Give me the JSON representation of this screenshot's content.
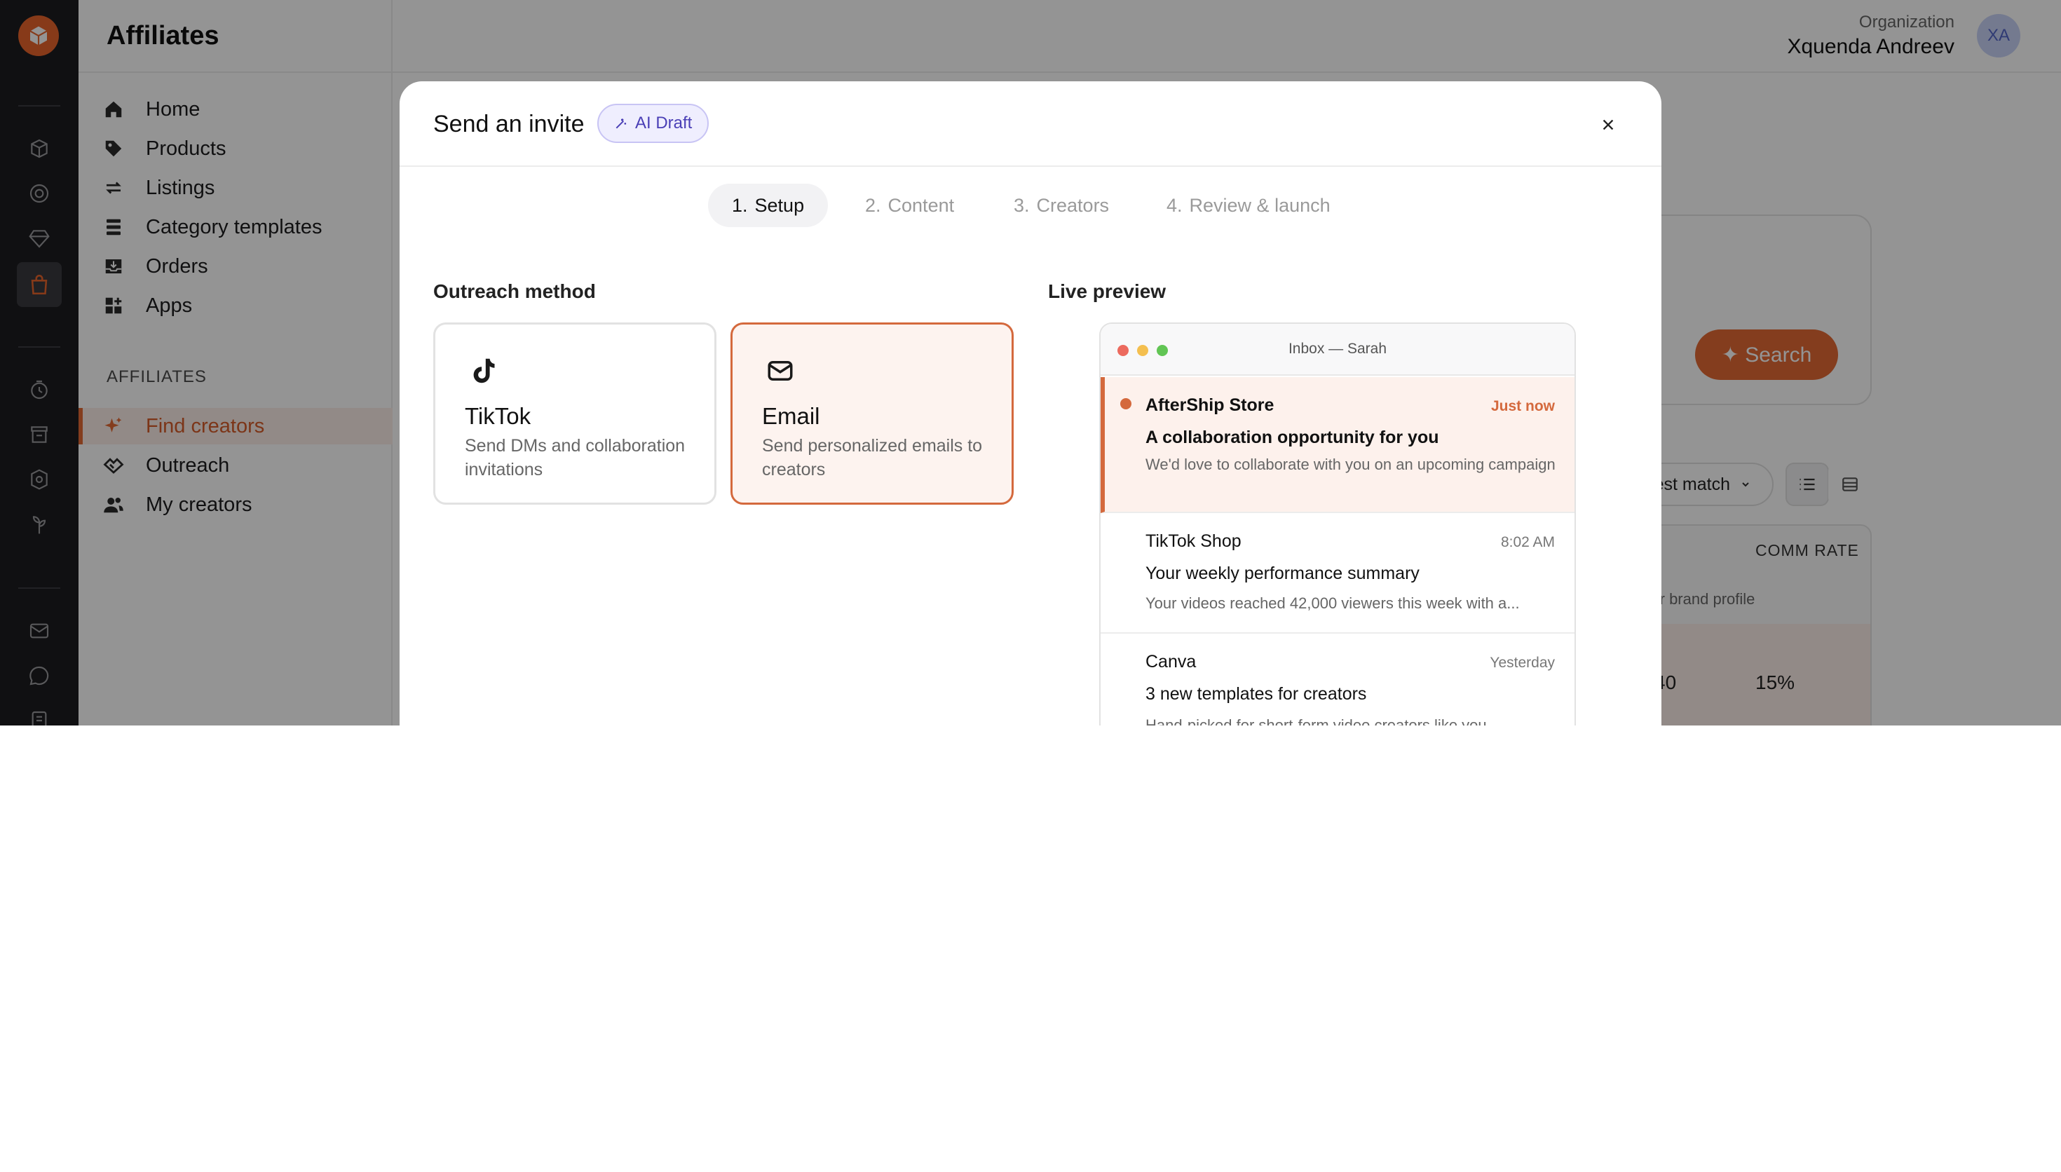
{
  "page": {
    "title": "Affiliates"
  },
  "org": {
    "label": "Organization",
    "name": "Xquenda Andreev",
    "initials": "XA"
  },
  "sidebar": {
    "items": [
      {
        "label": "Home",
        "icon": "home-icon"
      },
      {
        "label": "Products",
        "icon": "tag-icon"
      },
      {
        "label": "Listings",
        "icon": "sync-icon"
      },
      {
        "label": "Category templates",
        "icon": "layers-icon"
      },
      {
        "label": "Orders",
        "icon": "inbox-icon"
      },
      {
        "label": "Apps",
        "icon": "apps-icon"
      }
    ],
    "section_label": "AFFILIATES",
    "affiliate_items": [
      {
        "label": "Find creators",
        "icon": "sparkle-icon",
        "active": true
      },
      {
        "label": "Outreach",
        "icon": "handshake-icon"
      },
      {
        "label": "My creators",
        "icon": "users-icon"
      }
    ]
  },
  "background": {
    "search_fragment": "s",
    "search_button": "✦ Search",
    "sort_label": "est match",
    "column_header": "COMM RATE",
    "subtext": "sed on your brand profile",
    "value_a": "40",
    "value_b": "15%"
  },
  "modal": {
    "title": "Send an invite",
    "badge": "AI Draft",
    "steps": [
      {
        "num": "1.",
        "label": "Setup",
        "active": true
      },
      {
        "num": "2.",
        "label": "Content"
      },
      {
        "num": "3.",
        "label": "Creators"
      },
      {
        "num": "4.",
        "label": "Review & launch"
      }
    ],
    "outreach_title": "Outreach method",
    "methods": [
      {
        "title": "TikTok",
        "desc": "Send DMs and collaboration invitations",
        "icon": "tiktok-icon",
        "selected": false
      },
      {
        "title": "Email",
        "desc": "Send personalized emails to creators",
        "icon": "mail-icon",
        "selected": true
      }
    ],
    "preview_title": "Live preview",
    "inbox": {
      "title": "Inbox — Sarah",
      "messages": [
        {
          "sender": "AfterShip Store",
          "time": "Just now",
          "subject": "A collaboration opportunity for you",
          "preview": "We'd love to collaborate with you on an upcoming campaign",
          "unread": true
        },
        {
          "sender": "TikTok Shop",
          "time": "8:02 AM",
          "subject": "Your weekly performance summary",
          "preview": "Your videos reached 42,000 viewers this week with a..."
        },
        {
          "sender": "Canva",
          "time": "Yesterday",
          "subject": "3 new templates for creators",
          "preview": "Hand-picked for short-form video creators like you"
        }
      ]
    }
  },
  "colors": {
    "accent": "#e36a34",
    "rail": "#1d1d1f",
    "badge": "#4a3fb6"
  }
}
